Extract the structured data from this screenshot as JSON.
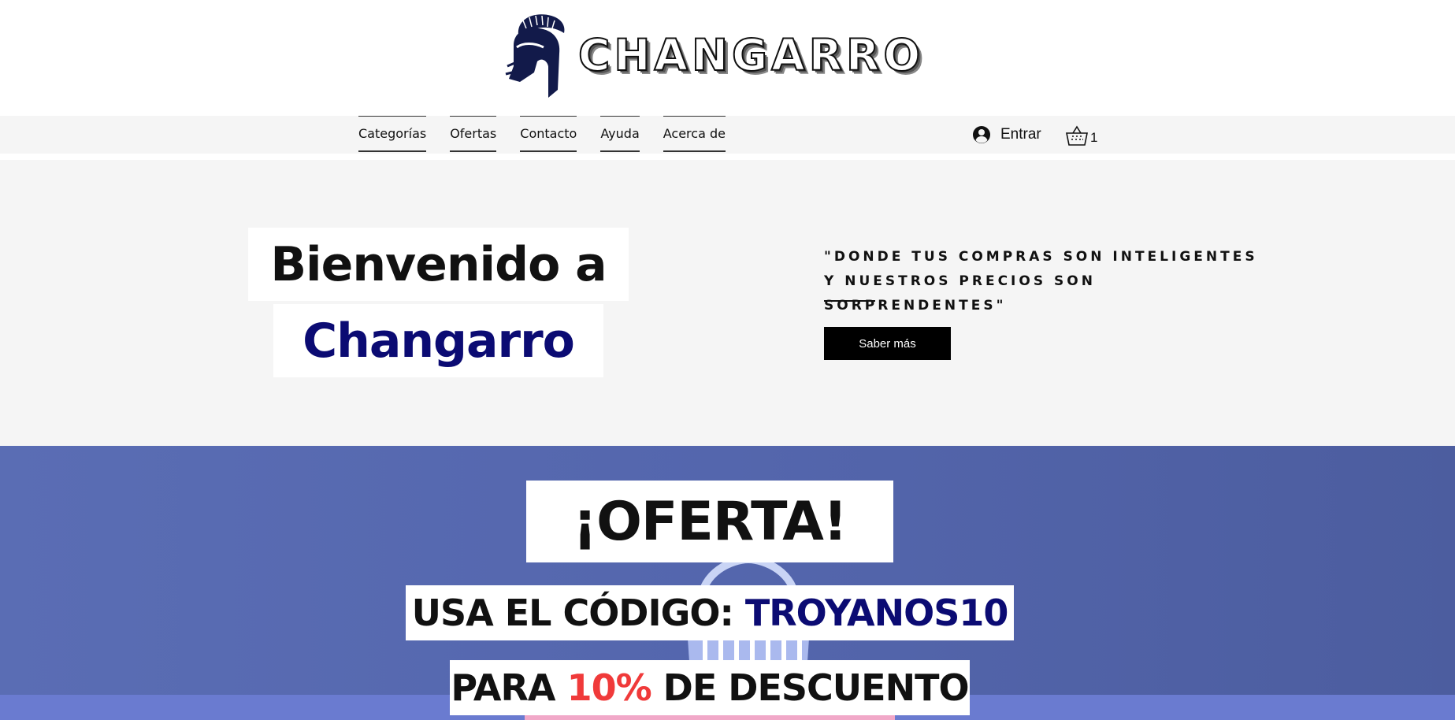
{
  "brand": {
    "name": "CHANGARRO",
    "logo_icon": "spartan-helmet-icon"
  },
  "nav": {
    "items": [
      {
        "label": "Categorías"
      },
      {
        "label": "Ofertas"
      },
      {
        "label": "Contacto"
      },
      {
        "label": "Ayuda"
      },
      {
        "label": "Acerca de"
      }
    ],
    "login": {
      "label": "Entrar",
      "icon": "user-avatar-icon"
    },
    "cart": {
      "count": "1",
      "icon": "basket-icon"
    }
  },
  "hero": {
    "title_line1": "Bienvenido a",
    "title_line2": "Changarro",
    "quote": "\"DONDE TUS COMPRAS SON INTELIGENTES Y NUESTROS PRECIOS SON SORPRENDENTES\"",
    "button_label": "Saber más"
  },
  "promo": {
    "headline": "¡OFERTA!",
    "code_prefix": "USA EL CÓDIGO: ",
    "code": "TROYANOS10",
    "discount_prefix": "PARA ",
    "discount_value": "10%",
    "discount_suffix": " DE DESCUENTO"
  },
  "colors": {
    "brand_navy": "#0b0b73",
    "promo_blue": "#5466ad",
    "discount_red": "#f03a3a",
    "button_black": "#000000",
    "band_gray": "#f5f5f5"
  }
}
